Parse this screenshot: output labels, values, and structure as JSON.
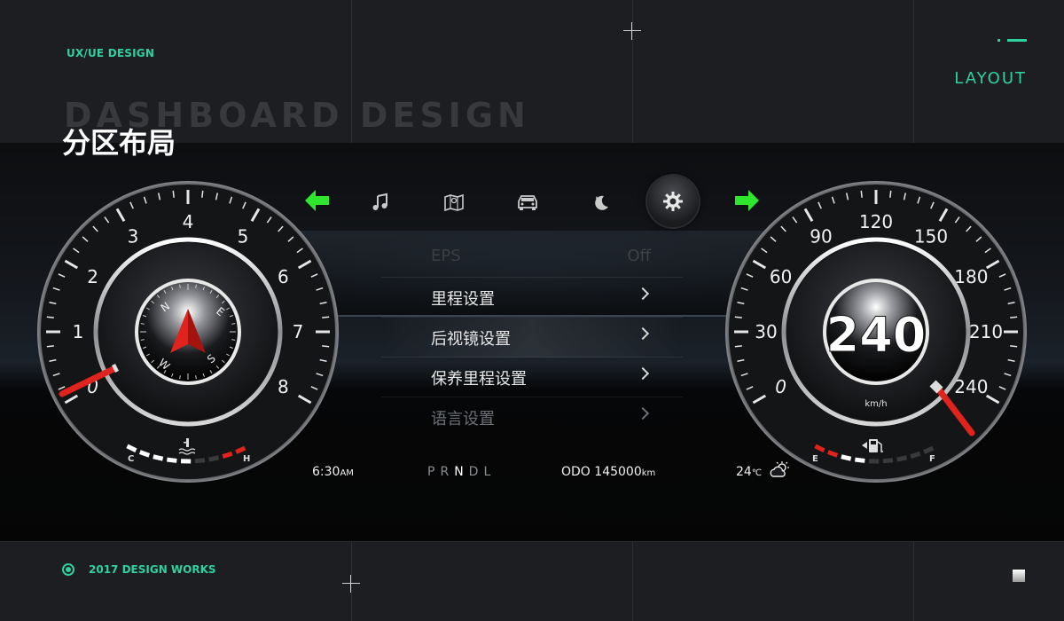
{
  "header": {
    "tag": "UX/UE DESIGN",
    "section_label": "LAYOUT",
    "background_title": "DASHBOARD  DESIGN",
    "title": "分区布局"
  },
  "footer": {
    "text": "2017 DESIGN WORKS"
  },
  "nav": {
    "icons": [
      "left-arrow-icon",
      "music-icon",
      "map-icon",
      "car-icon",
      "night-mode-icon",
      "settings-icon",
      "right-arrow-icon"
    ],
    "accent": "#2fe62f"
  },
  "menu": {
    "items": [
      {
        "label": "EPS",
        "value": "Off"
      },
      {
        "label": "里程设置"
      },
      {
        "label": "后视镜设置"
      },
      {
        "label": "保养里程设置"
      },
      {
        "label": "语言设置"
      }
    ]
  },
  "status": {
    "time": "6:30",
    "time_suffix": "AM",
    "gears": [
      "P",
      "R",
      "N",
      "D",
      "L"
    ],
    "selected_gear": "N",
    "odo_label": "ODO",
    "odo_value": "145000",
    "odo_unit": "km",
    "temp": "24",
    "temp_unit": "℃",
    "weather_icon": "partly-cloudy-icon"
  },
  "tachometer": {
    "labels": [
      "0",
      "1",
      "2",
      "3",
      "4",
      "5",
      "6",
      "7",
      "8"
    ],
    "temp_low": "C",
    "temp_high": "H",
    "temp_icon": "coolant-temp-icon",
    "compass_letters": [
      "N",
      "E",
      "S",
      "W"
    ]
  },
  "speedometer": {
    "labels": [
      "0",
      "30",
      "60",
      "90",
      "120",
      "150",
      "180",
      "210",
      "240"
    ],
    "speed": "240",
    "unit": "km/h",
    "fuel_low": "E",
    "fuel_high": "F",
    "fuel_icon": "fuel-pump-icon"
  },
  "colors": {
    "accent_green": "#2fd19c",
    "arrow_green": "#2fe62f",
    "needle_red": "#e0231c"
  }
}
